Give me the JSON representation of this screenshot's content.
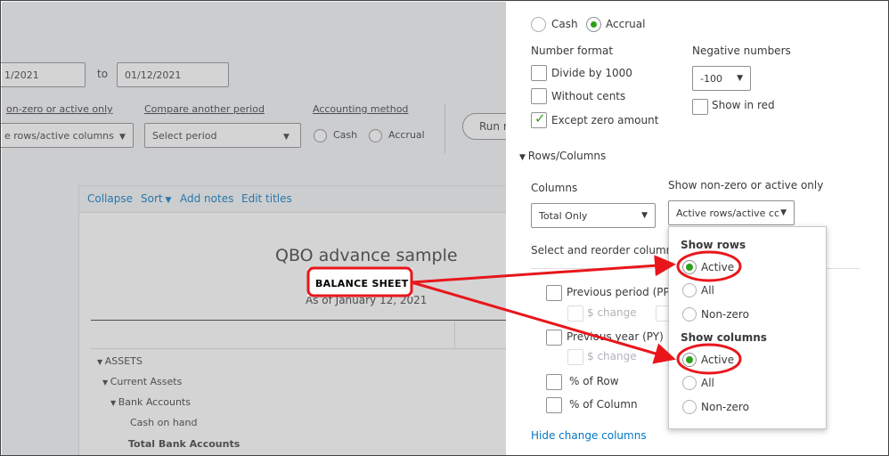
{
  "report_controls": {
    "from_date": "1/2021",
    "to_label": "to",
    "to_date": "01/12/2021",
    "show_nonzero_label": "on-zero or active only",
    "show_nonzero_value": "e rows/active columns",
    "compare_label": "Compare another period",
    "compare_placeholder": "Select period",
    "accounting_label": "Accounting method",
    "cash_label": "Cash",
    "accrual_label": "Accrual",
    "run_button": "Run r"
  },
  "report_toolbar": {
    "collapse": "Collapse",
    "sort": "Sort",
    "add_notes": "Add notes",
    "edit_titles": "Edit titles"
  },
  "report": {
    "company": "QBO advance sample",
    "title": "BALANCE SHEET",
    "as_of": "As of January 12, 2021",
    "rows": [
      {
        "label": "ASSETS"
      },
      {
        "label": "Current Assets"
      },
      {
        "label": "Bank Accounts"
      },
      {
        "label": "Cash on hand"
      },
      {
        "label": "Total Bank Accounts"
      }
    ]
  },
  "panel": {
    "cash_label": "Cash",
    "accrual_label": "Accrual",
    "number_format_label": "Number format",
    "divide_1000": "Divide by 1000",
    "without_cents": "Without cents",
    "except_zero": "Except zero amount",
    "negative_numbers_label": "Negative numbers",
    "negative_value": "-100",
    "show_in_red": "Show in red",
    "rows_columns_section": "Rows/Columns",
    "columns_label": "Columns",
    "columns_value": "Total Only",
    "show_nonzero_label": "Show non-zero or active only",
    "show_nonzero_value": "Active rows/active cc",
    "select_reorder": "Select and reorder columns",
    "previous_period": "Previous period (PP)",
    "dollar_change_1": "$ change",
    "previous_year": "Previous year (PY)",
    "dollar_change_2": "$ change",
    "pct_row": "% of Row",
    "pct_column": "% of Column",
    "hide_change_columns": "Hide change columns"
  },
  "popup": {
    "show_rows_heading": "Show rows",
    "rows_options": [
      "Active",
      "All",
      "Non-zero"
    ],
    "show_columns_heading": "Show columns",
    "columns_options": [
      "Active",
      "All",
      "Non-zero"
    ]
  },
  "colors": {
    "accent_green": "#2ca01c",
    "link_blue": "#0077c5",
    "annotation_red": "#e8161b"
  }
}
